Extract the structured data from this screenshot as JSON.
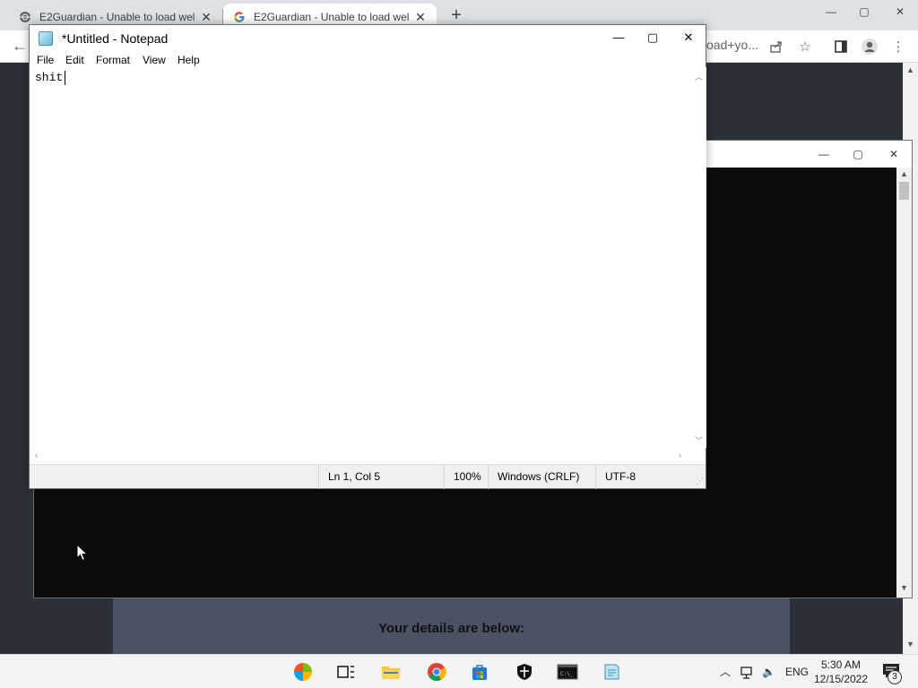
{
  "browser": {
    "tabs": [
      {
        "title": "E2Guardian - Unable to load wel"
      },
      {
        "title": "E2Guardian - Unable to load wel"
      }
    ],
    "new_tab": "+",
    "window_controls": {
      "minimize": "—",
      "maximize": "▢",
      "close": "✕"
    },
    "address_tail": "oad+yo...",
    "page": {
      "details_heading": "Your details are below:"
    }
  },
  "cmd_window": {
    "controls": {
      "minimize": "—",
      "maximize": "▢",
      "close": "✕"
    }
  },
  "notepad": {
    "title": "*Untitled - Notepad",
    "controls": {
      "minimize": "—",
      "maximize": "▢",
      "close": "✕"
    },
    "menu": [
      "File",
      "Edit",
      "Format",
      "View",
      "Help"
    ],
    "content": "shit",
    "status": {
      "position": "Ln 1, Col 5",
      "zoom": "100%",
      "line_ending": "Windows (CRLF)",
      "encoding": "UTF-8"
    }
  },
  "taskbar": {
    "apps": [
      "start-icon",
      "task-view-icon",
      "file-explorer-icon",
      "chrome-icon",
      "store-icon",
      "security-icon",
      "terminal-icon",
      "notepad-icon"
    ],
    "language": "ENG",
    "time": "5:30 AM",
    "date": "12/15/2022",
    "notification_count": "3"
  },
  "colors": {
    "page_background": "#2b2f38",
    "cmd_background": "#0c0c0c",
    "taskbar": "#f3f3f3"
  }
}
